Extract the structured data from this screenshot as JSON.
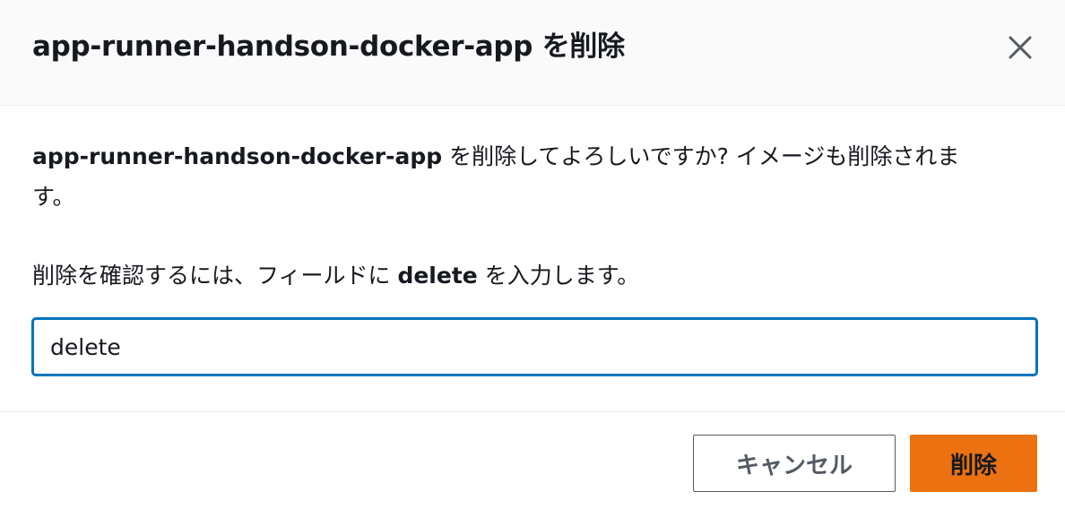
{
  "dialog": {
    "title_app_name": "app-runner-handson-docker-app",
    "title_suffix": " を削除",
    "close_label": "×"
  },
  "body": {
    "confirm_app_name": "app-runner-handson-docker-app",
    "confirm_rest": " を削除してよろしいですか? イメージも削除されます。",
    "instruction_prefix": "削除を確認するには、フィールドに ",
    "instruction_keyword": "delete",
    "instruction_suffix": " を入力します。",
    "input_value": "delete"
  },
  "footer": {
    "cancel_label": "キャンセル",
    "delete_label": "削除"
  },
  "colors": {
    "header_bg": "#fafafa",
    "focus_border": "#0073bb",
    "primary_button": "#ec7211",
    "secondary_border": "#545b64"
  }
}
